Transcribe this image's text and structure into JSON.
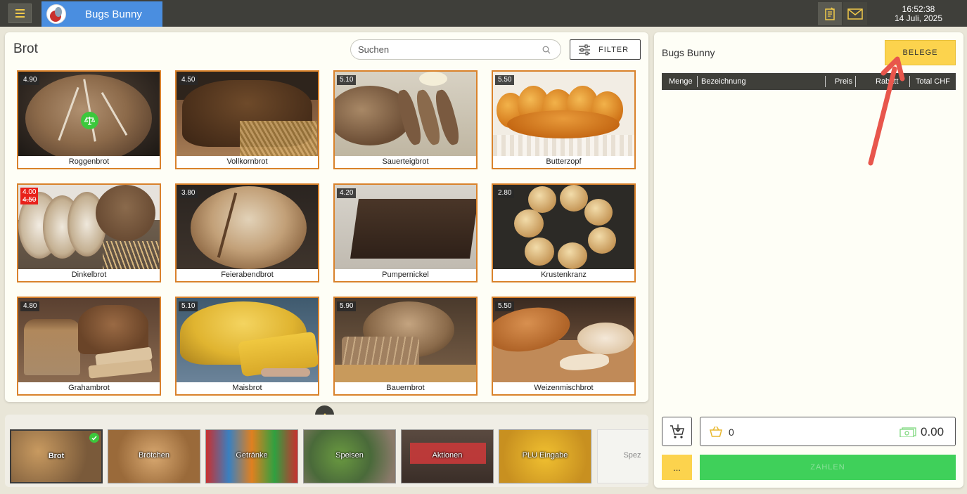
{
  "header": {
    "user_name": "Bugs Bunny",
    "time": "16:52:38",
    "date": "14 Juli, 2025"
  },
  "products_panel": {
    "category_title": "Brot",
    "search_placeholder": "Suchen",
    "filter_label": "FILTER",
    "products": [
      {
        "name": "Roggenbrot",
        "price": "4.90",
        "weighable": true
      },
      {
        "name": "Vollkornbrot",
        "price": "4.50"
      },
      {
        "name": "Sauerteigbrot",
        "price": "5.10"
      },
      {
        "name": "Butterzopf",
        "price": "5.50"
      },
      {
        "name": "Dinkelbrot",
        "price": "4.00",
        "old_price": "4.50"
      },
      {
        "name": "Feierabendbrot",
        "price": "3.80"
      },
      {
        "name": "Pumpernickel",
        "price": "4.20"
      },
      {
        "name": "Krustenkranz",
        "price": "2.80"
      },
      {
        "name": "Grahambrot",
        "price": "4.80"
      },
      {
        "name": "Maisbrot",
        "price": "5.10"
      },
      {
        "name": "Bauernbrot",
        "price": "5.90"
      },
      {
        "name": "Weizenmischbrot",
        "price": "5.50"
      }
    ]
  },
  "categories": [
    {
      "label": "Brot",
      "active": true
    },
    {
      "label": "Brötchen"
    },
    {
      "label": "Getränke"
    },
    {
      "label": "Speisen"
    },
    {
      "label": "Aktionen"
    },
    {
      "label": "PLU Eingabe"
    },
    {
      "label": "Spez"
    }
  ],
  "order_panel": {
    "customer_name": "Bugs Bunny",
    "belege_label": "BELEGE",
    "columns": {
      "menge": "Menge",
      "bezeichnung": "Bezeichnung",
      "preis": "Preis",
      "rabatt": "Rabatt",
      "total": "Total CHF"
    },
    "item_count": "0",
    "total": "0.00",
    "more_label": "...",
    "pay_label": "ZAHLEN"
  },
  "colors": {
    "accent_yellow": "#fcd34d",
    "tile_border": "#d9822b",
    "pay_green": "#3fd05a",
    "topbar": "#3f3f3a",
    "user_tab_blue": "#4a8ee0",
    "sale_red": "#e8201a"
  }
}
